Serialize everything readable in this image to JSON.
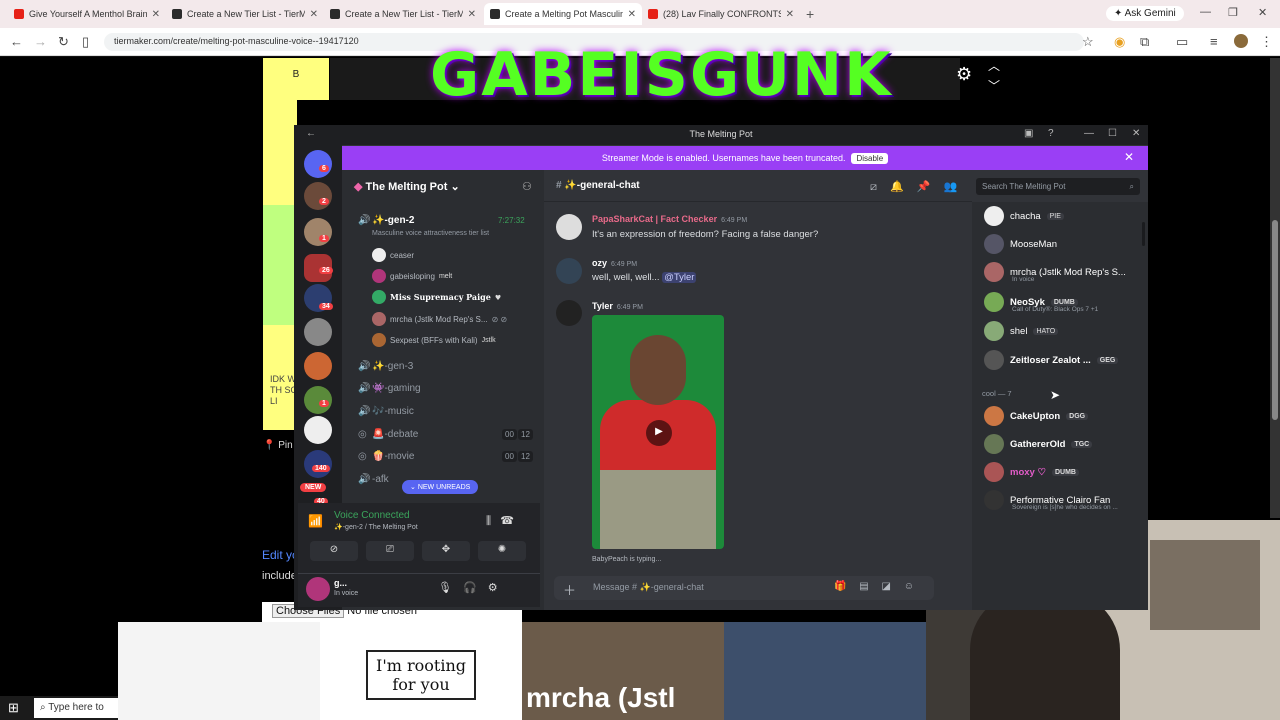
{
  "browser": {
    "tabs": [
      {
        "label": "Give Yourself A Menthol Brainrot",
        "color": "#e62117"
      },
      {
        "label": "Create a New Tier List - TierMaker",
        "color": "#2b2b2b"
      },
      {
        "label": "Create a New Tier List - TierMaker",
        "color": "#2b2b2b"
      },
      {
        "label": "Create a Melting Pot Masculine Voice",
        "color": "#2b2b2b"
      },
      {
        "label": "(28) Lav Finally CONFRONTS Da...",
        "color": "#e62117"
      }
    ],
    "new_tab": "+",
    "gemini": "Ask Gemini",
    "url": "tiermaker.com/create/melting-pot-masculine-voice--19417120",
    "window_controls": {
      "minimize": "—",
      "maximize": "❐",
      "close": "✕"
    }
  },
  "tierpage": {
    "tier_label": "B",
    "logo_text": "GABEISGUNK",
    "side_text": "IDK W TH SO LI",
    "pin_label": "Pin",
    "edit_label": "Edit yo",
    "include_label": "include",
    "choose_files": "Choose Files",
    "no_file": "No file chosen"
  },
  "thumbnails": {
    "t2_text": "I'm rooting for you",
    "t3_caption": "mrcha (Jstl"
  },
  "taskbar": {
    "search_placeholder": "Type here to"
  },
  "discord": {
    "window_title": "The Melting Pot",
    "banner_text": "Streamer Mode is enabled. Usernames have been truncated.",
    "banner_button": "Disable",
    "guild_badges": [
      "6",
      "2",
      "1",
      "26",
      "34",
      "1",
      "140",
      "40"
    ],
    "new_badge": "NEW",
    "server_name": "The Melting Pot",
    "channels": {
      "gen2": {
        "name": "✨-gen-2",
        "time": "7:27:32",
        "desc": "Masculine voice attractiveness tier list"
      },
      "voice_users": [
        {
          "name": "ceaser",
          "tag": ""
        },
        {
          "name": "gabeisloping",
          "tag": "melt"
        },
        {
          "name": "Miss Supremacy Paige",
          "tag": "♥"
        },
        {
          "name": "mrcha (Jstlk Mod Rep's S...",
          "tag": ""
        },
        {
          "name": "Sexpest (BFFs with Kali)",
          "tag": "Jstlk"
        }
      ],
      "list": [
        {
          "name": "✨-gen-3",
          "c1": "",
          "c2": ""
        },
        {
          "name": "👾-gaming",
          "c1": "",
          "c2": ""
        },
        {
          "name": "🎶-music",
          "c1": "",
          "c2": ""
        },
        {
          "name": "🚨-debate",
          "c1": "00",
          "c2": "12"
        },
        {
          "name": "🍿-movie",
          "c1": "00",
          "c2": "12"
        },
        {
          "name": "-afk",
          "c1": "",
          "c2": ""
        }
      ],
      "new_unreads": "NEW UNREADS"
    },
    "voice_panel": {
      "status": "Voice Connected",
      "location": "✨-gen-2 / The Melting Pot"
    },
    "user_panel": {
      "name": "g...",
      "status": "In voice"
    },
    "chat": {
      "channel_name": "✨-general-chat",
      "search_placeholder": "Search The Melting Pot",
      "messages": [
        {
          "author": "PapaSharkCat | Fact Checker",
          "time": "6:49 PM",
          "text": "It's an expression of freedom? Facing a false danger?",
          "color": "#e86a8a"
        },
        {
          "author": "ozy",
          "time": "6:49 PM",
          "text": "well, well, well...",
          "mention": "@Tyler",
          "color": "#ffffff"
        },
        {
          "author": "Tyler",
          "time": "6:49 PM",
          "text": "",
          "color": "#ffffff"
        }
      ],
      "typing": "BabyPeach is typing...",
      "composer_placeholder": "Message # ✨-general-chat"
    },
    "members": {
      "online": [
        {
          "name": "chacha",
          "tag": "PIE",
          "sub": "",
          "color": "#ffffff"
        },
        {
          "name": "MooseMan",
          "tag": "",
          "sub": "",
          "color": "#ffffff"
        },
        {
          "name": "mrcha (Jstlk Mod Rep's S...",
          "tag": "",
          "sub": "In voice",
          "color": "#ffffff"
        },
        {
          "name": "NeoSyk",
          "tag": "DUMB",
          "sub": "Call of Duty®: Black Ops 7 +1",
          "color": "#ffffff"
        },
        {
          "name": "shel",
          "tag": "HATO",
          "sub": "",
          "color": "#ffffff"
        },
        {
          "name": "Zeitloser Zealot ...",
          "tag": "GEG",
          "sub": "",
          "color": "#ffffff"
        }
      ],
      "cool_header": "cool — 7",
      "cool": [
        {
          "name": "CakeUpton",
          "tag": "DGG",
          "sub": "",
          "color": "#ffffff"
        },
        {
          "name": "GathererOld",
          "tag": "TGC",
          "sub": "",
          "color": "#ffffff"
        },
        {
          "name": "moxy ♡",
          "tag": "DUMB",
          "sub": "",
          "color": "#e35cc9"
        },
        {
          "name": "Performative Clairo Fan",
          "tag": "",
          "sub": "Sovereign is [s]he who decides on ...",
          "color": "#ffffff"
        }
      ]
    }
  }
}
